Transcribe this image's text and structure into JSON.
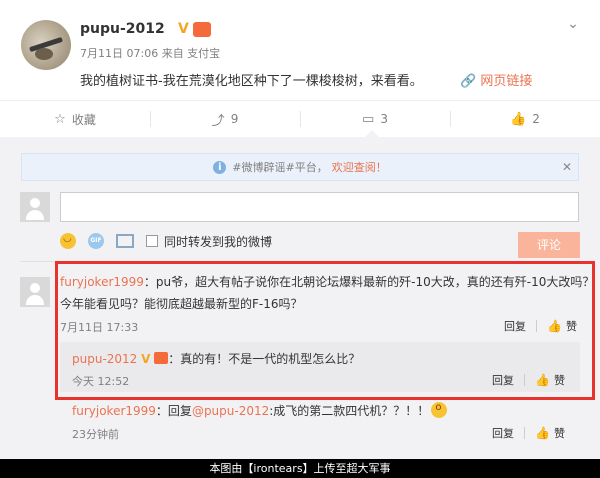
{
  "post": {
    "username": "pupu-2012",
    "verified_badge": "V",
    "member_badge": "",
    "meta": "7月11日 07:06 来自 支付宝",
    "content": "我的植树证书-我在荒漠化地区种下了一棵梭梭树，来看看。",
    "web_link_label": "网页链接",
    "chevron_icon": "chevron-down-icon"
  },
  "actions": {
    "favorite_label": "收藏",
    "repost_count": "9",
    "comment_count": "3",
    "like_count": "2"
  },
  "notice": {
    "text": "#微博辟谣#平台，",
    "link": "欢迎查阅！"
  },
  "composer": {
    "placeholder": "",
    "repost_checkbox_label": "同时转发到我的微博",
    "submit_label": "评论"
  },
  "comments": [
    {
      "user": "furyjoker1999",
      "text_line1": "：pu爷，超大有帖子说你在北朝论坛爆料最新的歼-10大改，真的还有歼-10大改吗？",
      "text_line2": "今年能看见吗？能彻底超越最新型的F-16吗？",
      "time": "7月11日 17:33",
      "reply_label": "回复",
      "like_label": "赞"
    },
    {
      "user": "pupu-2012",
      "text": "：真的有！不是一代的机型怎么比？",
      "time": "今天 12:52",
      "reply_label": "回复",
      "like_label": "赞"
    },
    {
      "user": "furyjoker1999",
      "text_prefix": "：回复",
      "mention": "@pupu-2012",
      "text_suffix": ":成飞的第二款四代机？？！！",
      "time": "23分钟前",
      "reply_label": "回复",
      "like_label": "赞"
    }
  ],
  "footer": {
    "caption": "本图由【irontears】上传至超大军事"
  },
  "colors": {
    "accent": "#eb7350",
    "highlight_border": "#e8322d",
    "panel_bg": "#f2f2f5"
  }
}
